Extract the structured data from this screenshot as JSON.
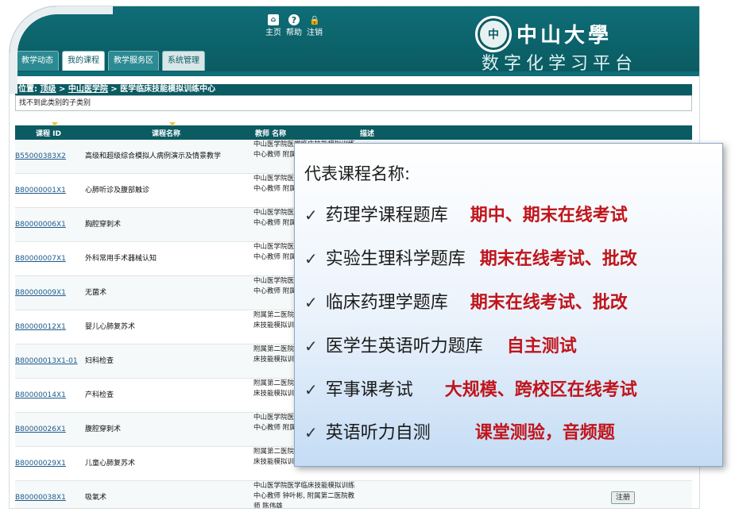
{
  "header": {
    "tools": [
      {
        "icon": "home-icon",
        "glyph": "⌂",
        "label": "主页"
      },
      {
        "icon": "help-icon",
        "glyph": "?",
        "label": "帮助"
      },
      {
        "icon": "lock-icon",
        "glyph": "🔒",
        "label": "注销"
      }
    ],
    "logo_name": "中山大學",
    "logo_sub": "数字化学习平台",
    "logo_seal": "中"
  },
  "tabs": [
    {
      "label": "教学动态"
    },
    {
      "label": "我的课程"
    },
    {
      "label": "教学服务区"
    },
    {
      "label": "系统管理"
    }
  ],
  "breadcrumb": {
    "prefix": "位置: ",
    "top": "顶级",
    "sep1": " > ",
    "school": "中山医学院",
    "sep2": " > ",
    "center": "医学临床技能模拟训练中心"
  },
  "notice": "找不到此类别的子类别",
  "table": {
    "headers": {
      "id": "课程 ID",
      "name": "课程名称",
      "teacher": "教师 名称",
      "desc": "描述"
    },
    "rows": [
      {
        "id": "B55000383X2",
        "name": "高级和超级综合模拟人病例演示及情景教学",
        "teacher": "中山医学院医学临床技能模拟训练中心教师 附属第二医院"
      },
      {
        "id": "B80000001X1",
        "name": "心肺听诊及腹部触诊",
        "teacher": "中山医学院医学临床技能模拟训练中心教师 附属第二医院"
      },
      {
        "id": "B80000006X1",
        "name": "胸腔穿刺术",
        "teacher": "中山医学院医学临床技能模拟训练中心教师 附属第二医院"
      },
      {
        "id": "B80000007X1",
        "name": "外科常用手术器械认知",
        "teacher": "中山医学院医学临床技能模拟训练中心教师 附属第二医院"
      },
      {
        "id": "B80000009X1",
        "name": "无菌术",
        "teacher": "中山医学院医学临床技能模拟训练中心教师 附属第二医院"
      },
      {
        "id": "B80000012X1",
        "name": "婴儿心肺复苏术",
        "teacher": "附属第二医院 中山医学院医学临床技能模拟训练中心"
      },
      {
        "id": "B80000013X1-01",
        "name": "妇科检查",
        "teacher": "附属第二医院 中山医学院医学临床技能模拟训练中心"
      },
      {
        "id": "B80000014X1",
        "name": "产科检查",
        "teacher": "附属第二医院 中山医学院医学临床技能模拟训练中心"
      },
      {
        "id": "B80000026X1",
        "name": "腹腔穿刺术",
        "teacher": "中山医学院医学临床技能模拟训练中心教师 附属第二医院"
      },
      {
        "id": "B80000029X1",
        "name": "儿童心肺复苏术",
        "teacher": "附属第二医院 中山医学院医学临床技能模拟训练中心教师 钟叶彬"
      },
      {
        "id": "B80000038X1",
        "name": "吸氧术",
        "teacher": "中山医学院医学临床技能模拟训练中心教师 钟叶彬, 附属第二医院教师 陈伟雄",
        "register": "注册"
      }
    ]
  },
  "overlay": {
    "title": "代表课程名称:",
    "check": "✓",
    "items": [
      {
        "name": "药理学课程题库",
        "note": "期中、期末在线考试"
      },
      {
        "name": "实验生理科学题库",
        "note": "期末在线考试、批改"
      },
      {
        "name": "临床药理学题库",
        "note": "期末在线考试、批改"
      },
      {
        "name": "医学生英语听力题库",
        "note": "自主测试"
      },
      {
        "name": "军事课考试",
        "note": "大规模、跨校区在线考试"
      },
      {
        "name": "英语听力自测",
        "note": "课堂测验，音频题"
      }
    ]
  }
}
